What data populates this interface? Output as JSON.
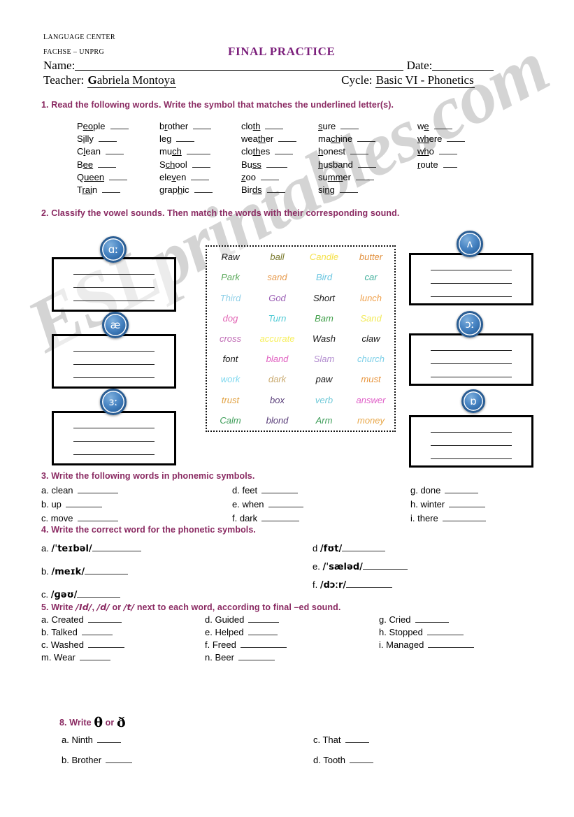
{
  "header": {
    "org_line1": "LANGUAGE CENTER",
    "org_line2": "FACHSE – UNPRG",
    "title": "FINAL PRACTICE",
    "name_label": "Name:",
    "date_label": "Date:",
    "teacher_label": "Teacher:",
    "teacher_value": "Gabriela Montoya",
    "cycle_label": "Cycle:",
    "cycle_value": "Basic VI - Phonetics"
  },
  "watermark": "ESLprintables.com",
  "accent_color": "#8a2a62",
  "title_color": "#7b1f7b",
  "exercise1": {
    "heading": "1. Read the following words. Write the symbol that matches the underlined letter(s).",
    "columns": [
      [
        {
          "pre": "P",
          "mid": "eo",
          "post": "ple",
          "blank": 26
        },
        {
          "pre": "S",
          "mid": "i",
          "post": "lly",
          "blank": 26
        },
        {
          "pre": "C",
          "mid": "l",
          "post": "ean",
          "blank": 26
        },
        {
          "pre": "B",
          "mid": "ee",
          "post": "",
          "blank": 26
        },
        {
          "pre": "Q",
          "mid": "ueen",
          "post": "",
          "blank": 26
        },
        {
          "pre": "T",
          "mid": "rai",
          "post": "n",
          "blank": 26
        }
      ],
      [
        {
          "pre": "b",
          "mid": "r",
          "post": "other",
          "blank": 26
        },
        {
          "pre": "le",
          "mid": "g",
          "post": "",
          "blank": 26
        },
        {
          "pre": "mu",
          "mid": "ch",
          "post": "",
          "blank": 34
        },
        {
          "pre": "S",
          "mid": "ch",
          "post": "ool",
          "blank": 26
        },
        {
          "pre": "ele",
          "mid": "v",
          "post": "en",
          "blank": 26
        },
        {
          "pre": "grap",
          "mid": "h",
          "post": "ic",
          "blank": 26
        }
      ],
      [
        {
          "pre": "clo",
          "mid": "th",
          "post": "",
          "blank": 26
        },
        {
          "pre": "wea",
          "mid": "th",
          "post": "er",
          "blank": 26
        },
        {
          "pre": "clo",
          "mid": "th",
          "post": "es",
          "blank": 26
        },
        {
          "pre": "Bu",
          "mid": "ss",
          "post": "",
          "blank": 30
        },
        {
          "pre": "",
          "mid": "z",
          "post": "oo",
          "blank": 26
        },
        {
          "pre": "Bir",
          "mid": "ds",
          "post": "",
          "blank": 26
        }
      ],
      [
        {
          "pre": "",
          "mid": "s",
          "post": "ure",
          "blank": 26
        },
        {
          "pre": "ma",
          "mid": "ch",
          "post": "ine",
          "blank": 26
        },
        {
          "pre": "",
          "mid": "h",
          "post": "onest",
          "blank": 26
        },
        {
          "pre": "",
          "mid": "h",
          "post": "usband",
          "blank": 26
        },
        {
          "pre": "su",
          "mid": "mm",
          "post": "er",
          "blank": 26
        },
        {
          "pre": "si",
          "mid": "ng",
          "post": "",
          "blank": 26
        }
      ],
      [
        {
          "pre": "w",
          "mid": "e",
          "post": "",
          "blank": 26
        },
        {
          "pre": "",
          "mid": "wh",
          "post": "ere",
          "blank": 26
        },
        {
          "pre": "",
          "mid": "wh",
          "post": "o",
          "blank": 26
        },
        {
          "pre": "",
          "mid": "r",
          "post": "oute",
          "blank": 20
        }
      ]
    ]
  },
  "exercise2": {
    "heading": "2. Classify the vowel sounds. Then match the words with their corresponding sound.",
    "left_badges": [
      "ɑː",
      "æ",
      "ɜː"
    ],
    "right_badges": [
      "ʌ",
      "ɔː",
      "ɒ"
    ],
    "wordbank": [
      {
        "text": "Raw",
        "color": "#1a1a1a"
      },
      {
        "text": "ball",
        "color": "#7a7a2e"
      },
      {
        "text": "Candle",
        "color": "#f5e14a"
      },
      {
        "text": "butter",
        "color": "#e2913f"
      },
      {
        "text": "Park",
        "color": "#5aa85a"
      },
      {
        "text": "sand",
        "color": "#e79a4c"
      },
      {
        "text": "Bird",
        "color": "#66c4e0"
      },
      {
        "text": "car",
        "color": "#3fae9a"
      },
      {
        "text": "Third",
        "color": "#8fd0e8"
      },
      {
        "text": "God",
        "color": "#9b5fb5"
      },
      {
        "text": "Short",
        "color": "#1a1a1a"
      },
      {
        "text": "lunch",
        "color": "#f0a04a"
      },
      {
        "text": "dog",
        "color": "#e266b5"
      },
      {
        "text": "Turn",
        "color": "#4fc9d4"
      },
      {
        "text": "Bam",
        "color": "#3f9e48"
      },
      {
        "text": "Sand",
        "color": "#f2ea5a"
      },
      {
        "text": "cross",
        "color": "#c06bb5"
      },
      {
        "text": "accurate",
        "color": "#f7ef5e"
      },
      {
        "text": "Wash",
        "color": "#1a1a1a"
      },
      {
        "text": "claw",
        "color": "#1a1a1a"
      },
      {
        "text": "font",
        "color": "#1a1a1a"
      },
      {
        "text": "bland",
        "color": "#e060c0"
      },
      {
        "text": "Slam",
        "color": "#b48fd0"
      },
      {
        "text": "church",
        "color": "#7fd0e8"
      },
      {
        "text": "work",
        "color": "#7fd8ef"
      },
      {
        "text": "dark",
        "color": "#c9a96e"
      },
      {
        "text": "paw",
        "color": "#1a1a1a"
      },
      {
        "text": "must",
        "color": "#e8963f"
      },
      {
        "text": "trust",
        "color": "#e0a040"
      },
      {
        "text": "box",
        "color": "#5a3f7a"
      },
      {
        "text": "verb",
        "color": "#6fc9d8"
      },
      {
        "text": "answer",
        "color": "#e060c8"
      },
      {
        "text": "Calm",
        "color": "#3f9e5a"
      },
      {
        "text": "blond",
        "color": "#5a3f7a"
      },
      {
        "text": "Arm",
        "color": "#3f9e5a"
      },
      {
        "text": "money",
        "color": "#e8a84a"
      }
    ]
  },
  "exercise3": {
    "heading": "3. Write the following words in phonemic symbols.",
    "col1": [
      {
        "label": "a. clean",
        "blank": 58
      },
      {
        "label": "b. up",
        "blank": 52
      },
      {
        "label": "c. move",
        "blank": 58
      }
    ],
    "col2": [
      {
        "label": "d. feet",
        "blank": 52
      },
      {
        "label": "e. when",
        "blank": 50
      },
      {
        "label": "f. dark",
        "blank": 54
      }
    ],
    "col3": [
      {
        "label": "g. done",
        "blank": 48
      },
      {
        "label": "h. winter",
        "blank": 52
      },
      {
        "label": "i. there",
        "blank": 62
      }
    ]
  },
  "exercise4": {
    "heading": "4. Write the correct word for the phonetic symbols.",
    "col1": [
      {
        "label": "a.",
        "phon": "/ˈteɪbəl/",
        "blank": 70
      },
      {
        "label": "b.",
        "phon": "/meɪk/",
        "blank": 62
      },
      {
        "label": "c.",
        "phon": "/ɡəʊ/",
        "blank": 62
      }
    ],
    "col2": [
      {
        "label": "d",
        "phon": "/fʊt/",
        "blank": 62
      },
      {
        "label": "e.",
        "phon": "/ˈsæləd/",
        "blank": 64
      },
      {
        "label": "f.",
        "phon": "/dɔːr/",
        "blank": 66
      }
    ]
  },
  "exercise5": {
    "heading_parts": [
      "5. Write ",
      "/Id/",
      ", ",
      "/d/",
      " or ",
      "/t/",
      " next to each word,  according to final –ed sound."
    ],
    "col1": [
      {
        "label": "a. Created",
        "blank": 48
      },
      {
        "label": "b. Talked",
        "blank": 44
      },
      {
        "label": "c. Washed",
        "blank": 52
      },
      {
        "label": "m. Wear",
        "blank": 44
      }
    ],
    "col2": [
      {
        "label": "d. Guided",
        "blank": 44
      },
      {
        "label": "e. Helped",
        "blank": 42
      },
      {
        "label": "f. Freed",
        "blank": 66
      },
      {
        "label": "n. Beer",
        "blank": 52
      }
    ],
    "col3": [
      {
        "label": "g. Cried",
        "blank": 48
      },
      {
        "label": "h. Stopped",
        "blank": 52
      },
      {
        "label": "i. Managed",
        "blank": 66
      }
    ]
  },
  "exercise8": {
    "num": "8.",
    "write": "Write",
    "symbol1": "θ",
    "or": "or",
    "symbol2": "ð",
    "col1": [
      {
        "label": "a.  Ninth",
        "blank": 34
      },
      {
        "label": "b.  Brother",
        "blank": 38
      }
    ],
    "col2": [
      {
        "label": "c.  That",
        "blank": 34
      },
      {
        "label": "d.  Tooth",
        "blank": 34
      }
    ]
  }
}
